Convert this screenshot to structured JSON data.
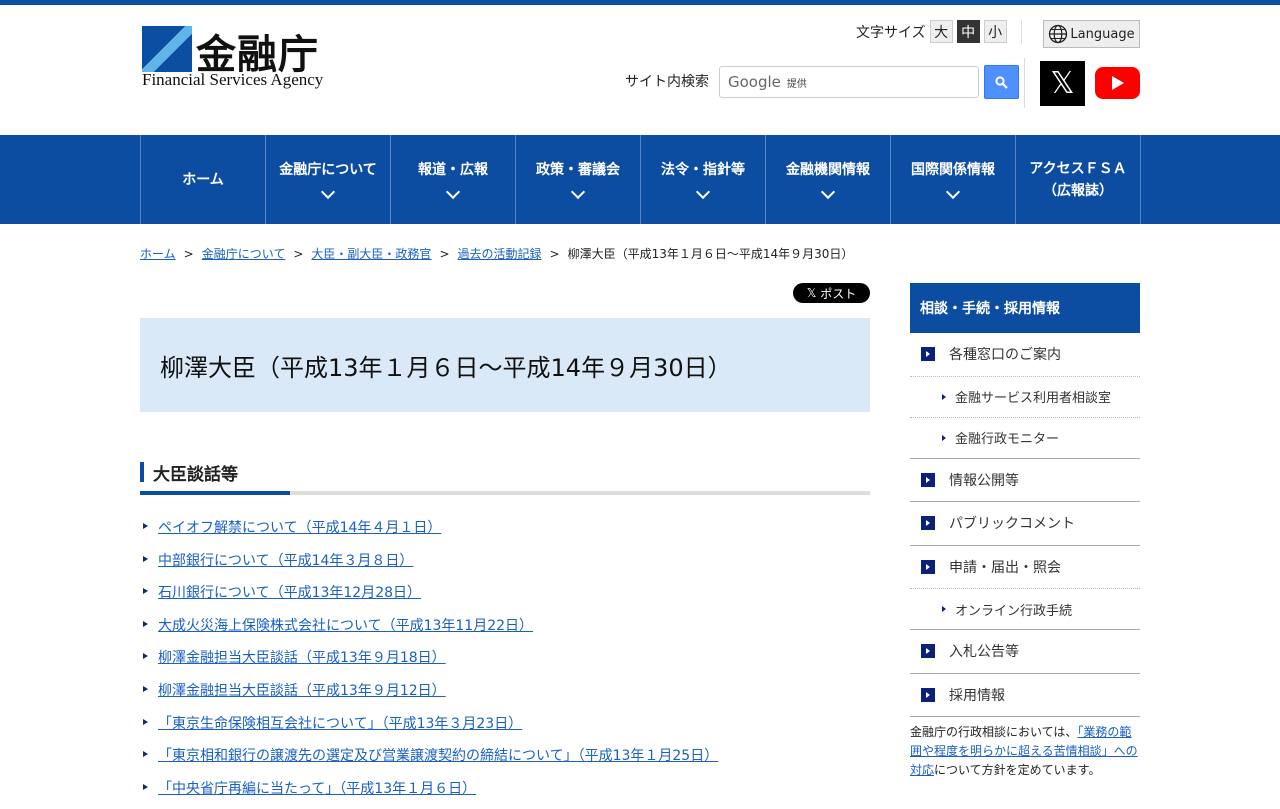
{
  "header": {
    "logo_jp": "金融庁",
    "logo_en": "Financial Services Agency",
    "font_size_label": "文字サイズ",
    "font_sizes": [
      "大",
      "中",
      "小"
    ],
    "language": "Language",
    "search_label": "サイト内検索",
    "search_brand": "Google",
    "search_provided": "提供"
  },
  "nav": [
    {
      "label": "ホーム"
    },
    {
      "label": "金融庁について"
    },
    {
      "label": "報道・広報"
    },
    {
      "label": "政策・審議会"
    },
    {
      "label": "法令・指針等"
    },
    {
      "label": "金融機関情報"
    },
    {
      "label": "国際関係情報"
    },
    {
      "label": "アクセスＦＳＡ",
      "label2": "（広報誌）"
    }
  ],
  "breadcrumb": [
    "ホーム",
    "金融庁について",
    "大臣・副大臣・政務官",
    "過去の活動記録",
    "柳澤大臣（平成13年１月６日～平成14年９月30日）"
  ],
  "post_label": "ポスト",
  "page_title": "柳澤大臣（平成13年１月６日～平成14年９月30日）",
  "section_heading": "大臣談話等",
  "links": [
    "ペイオフ解禁について（平成14年４月１日）",
    "中部銀行について（平成14年３月８日）",
    "石川銀行について（平成13年12月28日）",
    "大成火災海上保険株式会社について（平成13年11月22日）",
    "柳澤金融担当大臣談話（平成13年９月18日）",
    "柳澤金融担当大臣談話（平成13年９月12日）",
    "「東京生命保険相互会社について」（平成13年３月23日）",
    "「東京相和銀行の譲渡先の選定及び営業譲渡契約の締結について」（平成13年１月25日）",
    "「中央省庁再編に当たって」（平成13年１月６日）"
  ],
  "sidebar": {
    "title": "相談・手続・採用情報",
    "items": [
      "各種窓口のご案内",
      "金融サービス利用者相談室",
      "金融行政モニター",
      "情報公開等",
      "パブリックコメント",
      "申請・届出・照会",
      "オンライン行政手続",
      "入札公告等",
      "採用情報"
    ],
    "note_pre": "金融庁の行政相談においては、",
    "note_link": "「業務の範囲や程度を明らかに超える苦情相談」への対応",
    "note_post": "について方針を定めています。"
  }
}
